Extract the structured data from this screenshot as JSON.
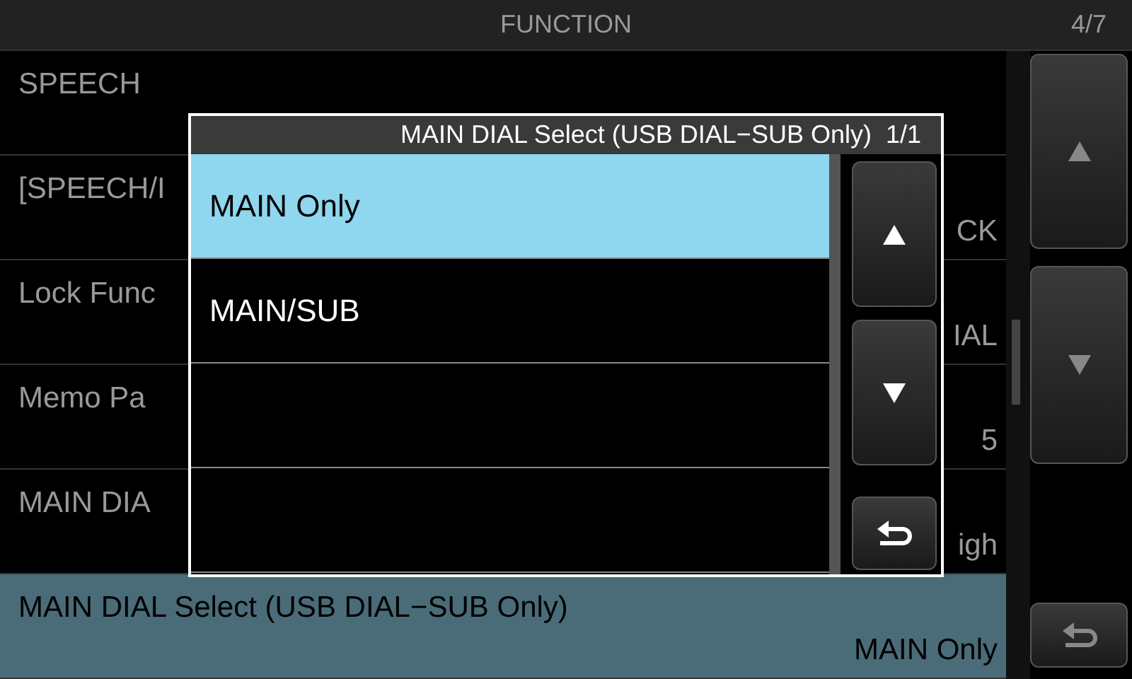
{
  "header": {
    "title": "FUNCTION",
    "page": "4/7"
  },
  "menu": [
    {
      "label": "SPEECH",
      "selected": false
    },
    {
      "label": "[SPEECH/I",
      "value": "CK",
      "selected": false
    },
    {
      "label": "Lock Func",
      "value": "IAL",
      "selected": false
    },
    {
      "label": "Memo Pa",
      "value": "5",
      "selected": false
    },
    {
      "label": "MAIN DIA",
      "value": "igh",
      "selected": false
    },
    {
      "label": "MAIN DIAL Select (USB DIAL−SUB Only)",
      "value": "MAIN Only",
      "selected": true
    }
  ],
  "dialog": {
    "title": "MAIN DIAL Select (USB DIAL−SUB Only)",
    "page": "1/1",
    "options": [
      {
        "label": "MAIN Only",
        "selected": true
      },
      {
        "label": "MAIN/SUB",
        "selected": false
      }
    ]
  }
}
